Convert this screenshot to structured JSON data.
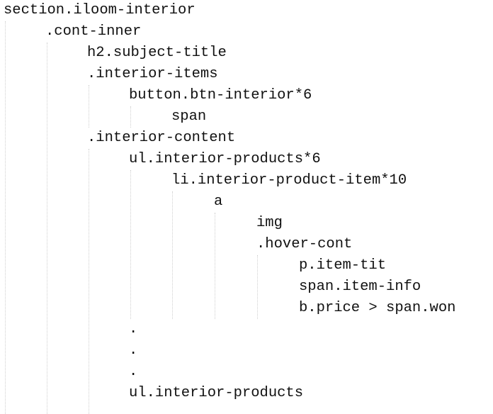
{
  "lines": [
    {
      "text": "section.iloom-interior",
      "level": 0
    },
    {
      "text": ".cont-inner",
      "level": 1
    },
    {
      "text": "h2.subject-title",
      "level": 2
    },
    {
      "text": ".interior-items",
      "level": 2
    },
    {
      "text": "button.btn-interior*6",
      "level": 3
    },
    {
      "text": "span",
      "level": 4
    },
    {
      "text": ".interior-content",
      "level": 2
    },
    {
      "text": "ul.interior-products*6",
      "level": 3
    },
    {
      "text": "li.interior-product-item*10",
      "level": 4
    },
    {
      "text": "a",
      "level": 5
    },
    {
      "text": "img",
      "level": 6
    },
    {
      "text": ".hover-cont",
      "level": 6
    },
    {
      "text": "p.item-tit",
      "level": 7
    },
    {
      "text": "span.item-info",
      "level": 7
    },
    {
      "text": "b.price > span.won",
      "level": 7
    },
    {
      "text": ".",
      "level": 3
    },
    {
      "text": ".",
      "level": 3
    },
    {
      "text": ".",
      "level": 3
    },
    {
      "text": "ul.interior-products",
      "level": 3
    }
  ]
}
